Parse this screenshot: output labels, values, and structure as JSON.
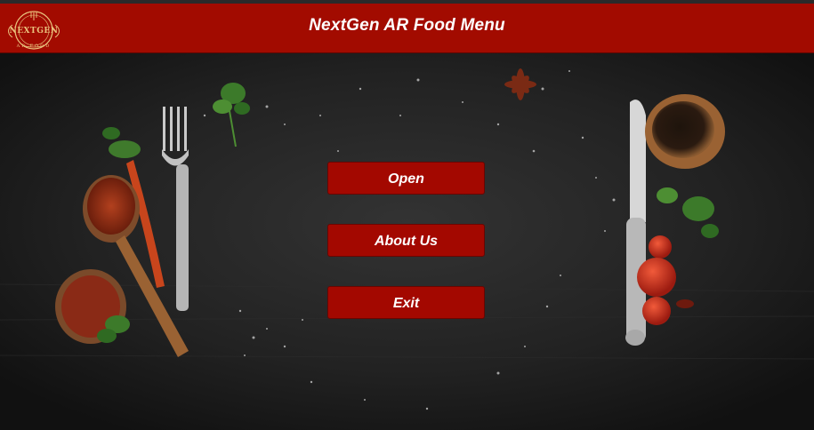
{
  "header": {
    "title": "NextGen AR Food Menu",
    "logo_text": "NEXTGEN",
    "logo_subtext": "AR FOOD"
  },
  "buttons": {
    "open": "Open",
    "about": "About Us",
    "exit": "Exit"
  },
  "colors": {
    "header_bg": "#a20b00",
    "button_bg": "#a30800",
    "background": "#1a1a1a",
    "logo_gold": "#e9c27d"
  }
}
